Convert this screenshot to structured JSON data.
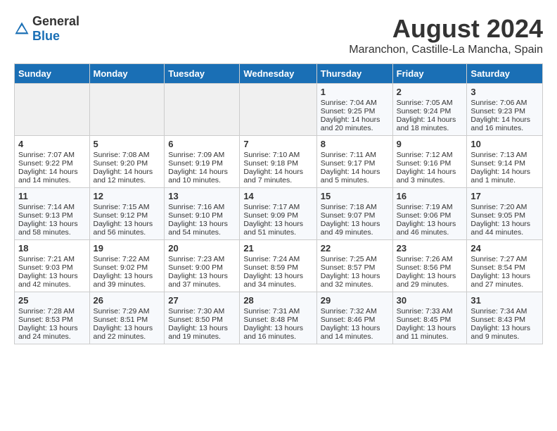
{
  "header": {
    "logo_general": "General",
    "logo_blue": "Blue",
    "month_year": "August 2024",
    "location": "Maranchon, Castille-La Mancha, Spain"
  },
  "weekdays": [
    "Sunday",
    "Monday",
    "Tuesday",
    "Wednesday",
    "Thursday",
    "Friday",
    "Saturday"
  ],
  "weeks": [
    [
      {
        "day": "",
        "empty": true
      },
      {
        "day": "",
        "empty": true
      },
      {
        "day": "",
        "empty": true
      },
      {
        "day": "",
        "empty": true
      },
      {
        "day": "1",
        "line1": "Sunrise: 7:04 AM",
        "line2": "Sunset: 9:25 PM",
        "line3": "Daylight: 14 hours",
        "line4": "and 20 minutes."
      },
      {
        "day": "2",
        "line1": "Sunrise: 7:05 AM",
        "line2": "Sunset: 9:24 PM",
        "line3": "Daylight: 14 hours",
        "line4": "and 18 minutes."
      },
      {
        "day": "3",
        "line1": "Sunrise: 7:06 AM",
        "line2": "Sunset: 9:23 PM",
        "line3": "Daylight: 14 hours",
        "line4": "and 16 minutes."
      }
    ],
    [
      {
        "day": "4",
        "line1": "Sunrise: 7:07 AM",
        "line2": "Sunset: 9:22 PM",
        "line3": "Daylight: 14 hours",
        "line4": "and 14 minutes."
      },
      {
        "day": "5",
        "line1": "Sunrise: 7:08 AM",
        "line2": "Sunset: 9:20 PM",
        "line3": "Daylight: 14 hours",
        "line4": "and 12 minutes."
      },
      {
        "day": "6",
        "line1": "Sunrise: 7:09 AM",
        "line2": "Sunset: 9:19 PM",
        "line3": "Daylight: 14 hours",
        "line4": "and 10 minutes."
      },
      {
        "day": "7",
        "line1": "Sunrise: 7:10 AM",
        "line2": "Sunset: 9:18 PM",
        "line3": "Daylight: 14 hours",
        "line4": "and 7 minutes."
      },
      {
        "day": "8",
        "line1": "Sunrise: 7:11 AM",
        "line2": "Sunset: 9:17 PM",
        "line3": "Daylight: 14 hours",
        "line4": "and 5 minutes."
      },
      {
        "day": "9",
        "line1": "Sunrise: 7:12 AM",
        "line2": "Sunset: 9:16 PM",
        "line3": "Daylight: 14 hours",
        "line4": "and 3 minutes."
      },
      {
        "day": "10",
        "line1": "Sunrise: 7:13 AM",
        "line2": "Sunset: 9:14 PM",
        "line3": "Daylight: 14 hours",
        "line4": "and 1 minute."
      }
    ],
    [
      {
        "day": "11",
        "line1": "Sunrise: 7:14 AM",
        "line2": "Sunset: 9:13 PM",
        "line3": "Daylight: 13 hours",
        "line4": "and 58 minutes."
      },
      {
        "day": "12",
        "line1": "Sunrise: 7:15 AM",
        "line2": "Sunset: 9:12 PM",
        "line3": "Daylight: 13 hours",
        "line4": "and 56 minutes."
      },
      {
        "day": "13",
        "line1": "Sunrise: 7:16 AM",
        "line2": "Sunset: 9:10 PM",
        "line3": "Daylight: 13 hours",
        "line4": "and 54 minutes."
      },
      {
        "day": "14",
        "line1": "Sunrise: 7:17 AM",
        "line2": "Sunset: 9:09 PM",
        "line3": "Daylight: 13 hours",
        "line4": "and 51 minutes."
      },
      {
        "day": "15",
        "line1": "Sunrise: 7:18 AM",
        "line2": "Sunset: 9:07 PM",
        "line3": "Daylight: 13 hours",
        "line4": "and 49 minutes."
      },
      {
        "day": "16",
        "line1": "Sunrise: 7:19 AM",
        "line2": "Sunset: 9:06 PM",
        "line3": "Daylight: 13 hours",
        "line4": "and 46 minutes."
      },
      {
        "day": "17",
        "line1": "Sunrise: 7:20 AM",
        "line2": "Sunset: 9:05 PM",
        "line3": "Daylight: 13 hours",
        "line4": "and 44 minutes."
      }
    ],
    [
      {
        "day": "18",
        "line1": "Sunrise: 7:21 AM",
        "line2": "Sunset: 9:03 PM",
        "line3": "Daylight: 13 hours",
        "line4": "and 42 minutes."
      },
      {
        "day": "19",
        "line1": "Sunrise: 7:22 AM",
        "line2": "Sunset: 9:02 PM",
        "line3": "Daylight: 13 hours",
        "line4": "and 39 minutes."
      },
      {
        "day": "20",
        "line1": "Sunrise: 7:23 AM",
        "line2": "Sunset: 9:00 PM",
        "line3": "Daylight: 13 hours",
        "line4": "and 37 minutes."
      },
      {
        "day": "21",
        "line1": "Sunrise: 7:24 AM",
        "line2": "Sunset: 8:59 PM",
        "line3": "Daylight: 13 hours",
        "line4": "and 34 minutes."
      },
      {
        "day": "22",
        "line1": "Sunrise: 7:25 AM",
        "line2": "Sunset: 8:57 PM",
        "line3": "Daylight: 13 hours",
        "line4": "and 32 minutes."
      },
      {
        "day": "23",
        "line1": "Sunrise: 7:26 AM",
        "line2": "Sunset: 8:56 PM",
        "line3": "Daylight: 13 hours",
        "line4": "and 29 minutes."
      },
      {
        "day": "24",
        "line1": "Sunrise: 7:27 AM",
        "line2": "Sunset: 8:54 PM",
        "line3": "Daylight: 13 hours",
        "line4": "and 27 minutes."
      }
    ],
    [
      {
        "day": "25",
        "line1": "Sunrise: 7:28 AM",
        "line2": "Sunset: 8:53 PM",
        "line3": "Daylight: 13 hours",
        "line4": "and 24 minutes."
      },
      {
        "day": "26",
        "line1": "Sunrise: 7:29 AM",
        "line2": "Sunset: 8:51 PM",
        "line3": "Daylight: 13 hours",
        "line4": "and 22 minutes."
      },
      {
        "day": "27",
        "line1": "Sunrise: 7:30 AM",
        "line2": "Sunset: 8:50 PM",
        "line3": "Daylight: 13 hours",
        "line4": "and 19 minutes."
      },
      {
        "day": "28",
        "line1": "Sunrise: 7:31 AM",
        "line2": "Sunset: 8:48 PM",
        "line3": "Daylight: 13 hours",
        "line4": "and 16 minutes."
      },
      {
        "day": "29",
        "line1": "Sunrise: 7:32 AM",
        "line2": "Sunset: 8:46 PM",
        "line3": "Daylight: 13 hours",
        "line4": "and 14 minutes."
      },
      {
        "day": "30",
        "line1": "Sunrise: 7:33 AM",
        "line2": "Sunset: 8:45 PM",
        "line3": "Daylight: 13 hours",
        "line4": "and 11 minutes."
      },
      {
        "day": "31",
        "line1": "Sunrise: 7:34 AM",
        "line2": "Sunset: 8:43 PM",
        "line3": "Daylight: 13 hours",
        "line4": "and 9 minutes."
      }
    ]
  ]
}
